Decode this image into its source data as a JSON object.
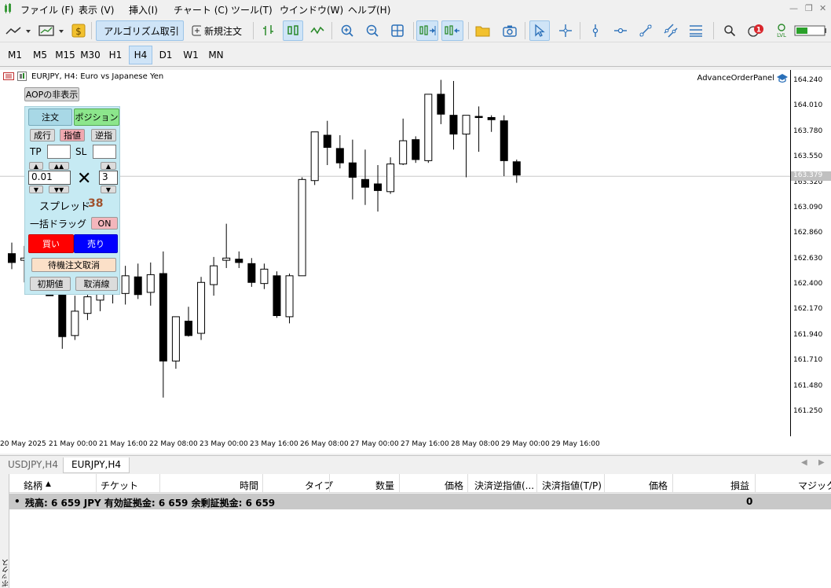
{
  "menu": [
    "ファイル (F)",
    "表示 (V)",
    "挿入(I)",
    "チャート (C)",
    "ツール(T)",
    "ウインドウ(W)",
    "ヘルプ(H)"
  ],
  "toolbar": {
    "algo_label": "アルゴリズム取引",
    "new_order_label": "新規注文",
    "notification_count": "1"
  },
  "timeframes": [
    "M1",
    "M5",
    "M15",
    "M30",
    "H1",
    "H4",
    "D1",
    "W1",
    "MN"
  ],
  "active_timeframe": "H4",
  "chart": {
    "title": "EURJPY, H4:  Euro vs Japanese Yen",
    "aop_label": "AdvanceOrderPanel",
    "current_price": "163.379"
  },
  "chart_data": {
    "type": "candlestick",
    "symbol": "EURJPY",
    "timeframe": "H4",
    "price_ticks": [
      "164.240",
      "164.010",
      "163.780",
      "163.550",
      "163.320",
      "163.090",
      "162.860",
      "162.630",
      "162.400",
      "162.170",
      "161.940",
      "161.710",
      "161.480",
      "161.250"
    ],
    "time_ticks": [
      "20 May 2025",
      "21 May 00:00",
      "21 May 16:00",
      "22 May 08:00",
      "23 May 00:00",
      "23 May 16:00",
      "26 May 08:00",
      "27 May 00:00",
      "27 May 16:00",
      "28 May 08:00",
      "29 May 00:00",
      "29 May 16:00"
    ],
    "candles": [
      {
        "o": 162.68,
        "h": 162.78,
        "l": 162.54,
        "c": 162.6
      },
      {
        "o": 162.62,
        "h": 162.75,
        "l": 162.42,
        "c": 162.64
      },
      {
        "o": 162.52,
        "h": 162.7,
        "l": 162.39,
        "c": 162.41
      },
      {
        "o": 162.41,
        "h": 162.35,
        "l": 162.3,
        "c": 162.3
      },
      {
        "o": 162.35,
        "h": 162.42,
        "l": 161.82,
        "c": 161.93
      },
      {
        "o": 161.94,
        "h": 162.3,
        "l": 161.9,
        "c": 162.16
      },
      {
        "o": 162.14,
        "h": 162.49,
        "l": 162.08,
        "c": 162.29
      },
      {
        "o": 162.26,
        "h": 162.51,
        "l": 162.16,
        "c": 162.38
      },
      {
        "o": 162.35,
        "h": 162.53,
        "l": 162.23,
        "c": 162.46
      },
      {
        "o": 162.32,
        "h": 162.57,
        "l": 162.22,
        "c": 162.48
      },
      {
        "o": 162.47,
        "h": 162.59,
        "l": 162.27,
        "c": 162.31
      },
      {
        "o": 162.33,
        "h": 162.6,
        "l": 162.21,
        "c": 162.49
      },
      {
        "o": 162.5,
        "h": 162.7,
        "l": 161.38,
        "c": 161.71
      },
      {
        "o": 161.71,
        "h": 162.09,
        "l": 161.64,
        "c": 162.11
      },
      {
        "o": 162.07,
        "h": 162.2,
        "l": 161.93,
        "c": 161.94
      },
      {
        "o": 161.96,
        "h": 162.47,
        "l": 161.9,
        "c": 162.42
      },
      {
        "o": 162.4,
        "h": 162.65,
        "l": 162.3,
        "c": 162.57
      },
      {
        "o": 162.62,
        "h": 162.95,
        "l": 162.55,
        "c": 162.64
      },
      {
        "o": 162.63,
        "h": 162.7,
        "l": 162.55,
        "c": 162.6
      },
      {
        "o": 162.59,
        "h": 162.64,
        "l": 162.38,
        "c": 162.42
      },
      {
        "o": 162.41,
        "h": 162.59,
        "l": 162.36,
        "c": 162.54
      },
      {
        "o": 162.48,
        "h": 162.52,
        "l": 162.1,
        "c": 162.12
      },
      {
        "o": 162.11,
        "h": 162.5,
        "l": 162.05,
        "c": 162.48
      },
      {
        "o": 162.48,
        "h": 163.37,
        "l": 162.48,
        "c": 163.35
      },
      {
        "o": 163.34,
        "h": 163.77,
        "l": 163.3,
        "c": 163.78
      },
      {
        "o": 163.75,
        "h": 163.88,
        "l": 163.48,
        "c": 163.64
      },
      {
        "o": 163.63,
        "h": 163.75,
        "l": 163.45,
        "c": 163.5
      },
      {
        "o": 163.5,
        "h": 163.71,
        "l": 163.17,
        "c": 163.37
      },
      {
        "o": 163.35,
        "h": 163.62,
        "l": 163.12,
        "c": 163.28
      },
      {
        "o": 163.31,
        "h": 163.48,
        "l": 163.06,
        "c": 163.25
      },
      {
        "o": 163.24,
        "h": 163.55,
        "l": 163.22,
        "c": 163.49
      },
      {
        "o": 163.49,
        "h": 163.9,
        "l": 163.48,
        "c": 163.7
      },
      {
        "o": 163.71,
        "h": 163.74,
        "l": 163.5,
        "c": 163.53
      },
      {
        "o": 163.52,
        "h": 164.12,
        "l": 163.5,
        "c": 164.12
      },
      {
        "o": 164.12,
        "h": 164.25,
        "l": 163.85,
        "c": 163.94
      },
      {
        "o": 163.93,
        "h": 164.24,
        "l": 163.62,
        "c": 163.76
      },
      {
        "o": 163.76,
        "h": 163.92,
        "l": 163.37,
        "c": 163.93
      },
      {
        "o": 163.92,
        "h": 164.01,
        "l": 163.6,
        "c": 163.91
      },
      {
        "o": 163.91,
        "h": 163.93,
        "l": 163.78,
        "c": 163.89
      },
      {
        "o": 163.88,
        "h": 163.93,
        "l": 163.38,
        "c": 163.52
      },
      {
        "o": 163.51,
        "h": 163.53,
        "l": 163.32,
        "c": 163.39
      }
    ]
  },
  "panel": {
    "hide_btn": "AOPの非表示",
    "tab_order": "注文",
    "tab_position": "ポジション",
    "market": "成行",
    "limit": "指値",
    "stop": "逆指",
    "tp_label": "TP",
    "sl_label": "SL",
    "lot": "0.01",
    "mult_sign": "✕",
    "multiplier": "3",
    "spread_label": "スプレッド",
    "spread_value": "38",
    "drag_label": "一括ドラッグ",
    "drag_toggle": "ON",
    "buy": "買い",
    "sell": "売り",
    "cancel_pending": "待機注文取消",
    "reset": "初期値",
    "cancel_line": "取消線",
    "up_single": "▲",
    "up_double": "▲▲",
    "down_single": "▼",
    "down_double": "▼▼"
  },
  "tabs": [
    "USDJPY,H4",
    "EURJPY,H4"
  ],
  "active_tab": "EURJPY,H4",
  "table": {
    "headers": [
      "銘柄",
      "チケット",
      "時間",
      "タイプ",
      "数量",
      "価格",
      "決済逆指値(...",
      "決済指値(T/P)",
      "価格",
      "損益",
      "マジック"
    ],
    "sort_indicator": "▲",
    "balance_bullet": "•",
    "balance": "残高: 6 659 JPY  有効証拠金: 6 659  余剰証拠金: 6 659",
    "profit": "0"
  },
  "side_tab": "ボックス"
}
